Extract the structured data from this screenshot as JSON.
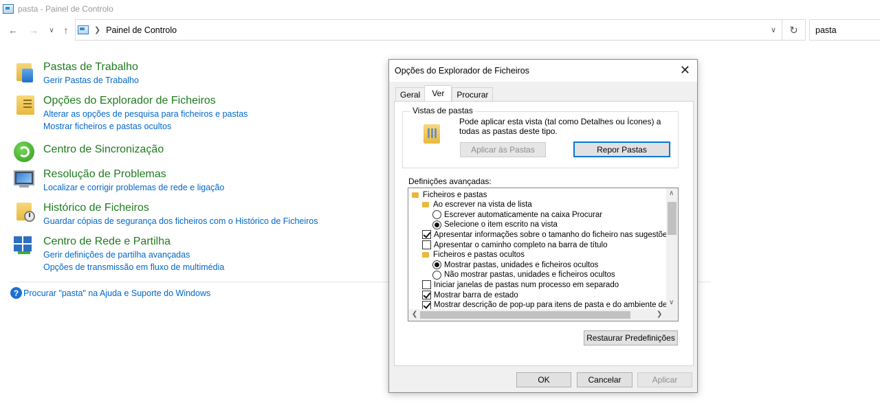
{
  "window": {
    "title": "pasta - Painel de Controlo"
  },
  "address": {
    "path": "Painel de Controlo",
    "search_value": "pasta"
  },
  "results": [
    {
      "title": "Pastas de Trabalho",
      "links": [
        "Gerir Pastas de Trabalho"
      ],
      "icon": "work-folders-icon"
    },
    {
      "title": "Opções do Explorador de Ficheiros",
      "links": [
        "Alterar as opções de pesquisa para ficheiros e pastas",
        "Mostrar ficheiros e pastas ocultos"
      ],
      "icon": "folder-options-icon"
    },
    {
      "title": "Centro de Sincronização",
      "links": [],
      "icon": "sync-center-icon"
    },
    {
      "title": "Resolução de Problemas",
      "links": [
        "Localizar e corrigir problemas de rede e ligação"
      ],
      "icon": "troubleshooting-icon"
    },
    {
      "title": "Histórico de Ficheiros",
      "links": [
        "Guardar cópias de segurança dos ficheiros com o Histórico de Ficheiros"
      ],
      "icon": "file-history-icon"
    },
    {
      "title": "Centro de Rede e Partilha",
      "links": [
        "Gerir definições de partilha avançadas",
        "Opções de transmissão em fluxo de multimédia"
      ],
      "icon": "network-sharing-icon"
    }
  ],
  "help_link": "Procurar \"pasta\" na Ajuda e Suporte do Windows",
  "dialog": {
    "title": "Opções do Explorador de Ficheiros",
    "tabs": [
      "Geral",
      "Ver",
      "Procurar"
    ],
    "active_tab": "Ver",
    "folder_views": {
      "label": "Vistas de pastas",
      "description": "Pode aplicar esta vista (tal como Detalhes ou Ícones) a todas as pastas deste tipo.",
      "apply_button": "Aplicar às Pastas",
      "reset_button": "Repor Pastas"
    },
    "advanced_label": "Definições avançadas:",
    "settings": [
      {
        "type": "folder",
        "label": "Ficheiros e pastas",
        "indent": 0
      },
      {
        "type": "folder",
        "label": "Ao escrever na vista de lista",
        "indent": 1
      },
      {
        "type": "radio",
        "label": "Escrever automaticamente na caixa Procurar",
        "checked": false,
        "indent": 2
      },
      {
        "type": "radio",
        "label": "Selecione o item escrito na vista",
        "checked": true,
        "indent": 2
      },
      {
        "type": "checkbox",
        "label": "Apresentar informações sobre o tamanho do ficheiro nas sugestões d",
        "checked": true,
        "indent": 1
      },
      {
        "type": "checkbox",
        "label": "Apresentar o caminho completo na barra de título",
        "checked": false,
        "indent": 1
      },
      {
        "type": "folder",
        "label": "Ficheiros e pastas ocultos",
        "indent": 1
      },
      {
        "type": "radio",
        "label": "Mostrar pastas, unidades e ficheiros ocultos",
        "checked": true,
        "indent": 2
      },
      {
        "type": "radio",
        "label": "Não mostrar pastas, unidades e ficheiros ocultos",
        "checked": false,
        "indent": 2
      },
      {
        "type": "checkbox",
        "label": "Iniciar janelas de pastas num processo em separado",
        "checked": false,
        "indent": 1
      },
      {
        "type": "checkbox",
        "label": "Mostrar barra de estado",
        "checked": true,
        "indent": 1
      },
      {
        "type": "checkbox",
        "label": "Mostrar descrição de pop-up para itens de pasta e do ambiente de tra",
        "checked": true,
        "indent": 1
      }
    ],
    "restore_button": "Restaurar Predefinições",
    "ok_button": "OK",
    "cancel_button": "Cancelar",
    "apply_button": "Aplicar"
  }
}
